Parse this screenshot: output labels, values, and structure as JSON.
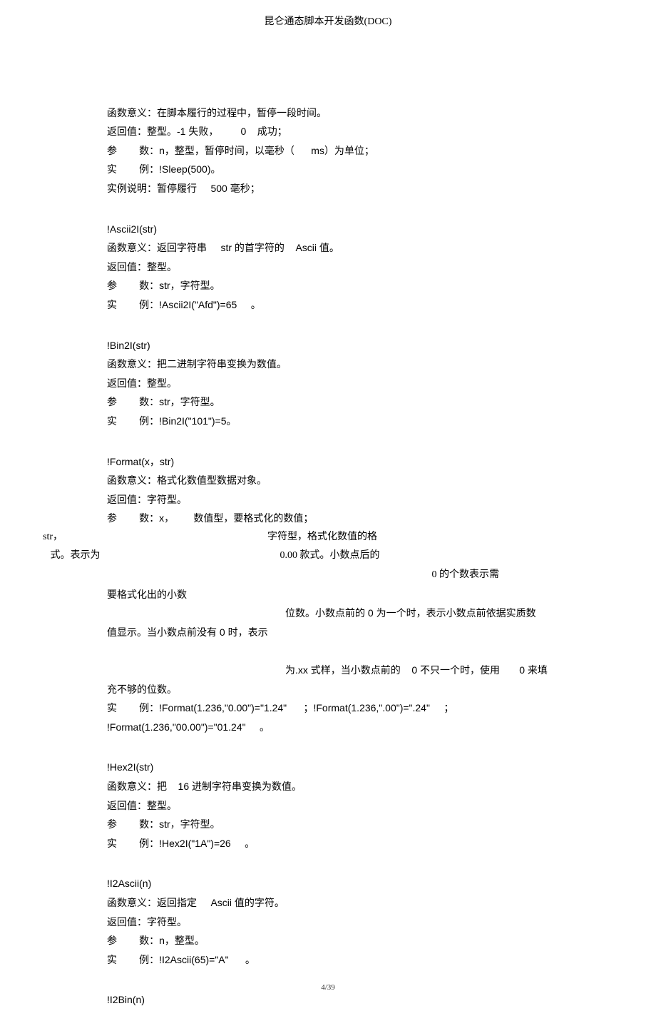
{
  "header": "昆仑通态脚本开发函数(DOC)",
  "footer": "4/39",
  "s1": {
    "l1": "函数意义：在脚本履行的过程中，暂停一段时间。",
    "l2": "返回值：整型。-1 失败，        0    成功；",
    "l3": "参        数：n，整型，暂停时间，以毫秒（      ms）为单位；",
    "l4": "实        例：!Sleep(500)。",
    "l5": "实例说明：暂停履行     500 毫秒；"
  },
  "s2": {
    "l1": "!Ascii2I(str)",
    "l2": "函数意义：返回字符串     str 的首字符的    Ascii 值。",
    "l3": "返回值：整型。",
    "l4": "参        数：str，字符型。",
    "l5": "实        例：!Ascii2I(\"Afd\")=65     。"
  },
  "s3": {
    "l1": "!Bin2I(str)",
    "l2": "函数意义：把二进制字符串变换为数值。",
    "l3": "返回值：整型。",
    "l4": "参        数：str，字符型。",
    "l5": "实        例：!Bin2I(\"101\")=5。"
  },
  "s4": {
    "l1": "!Format(x，str)",
    "l2": "函数意义：格式化数值型数据对象。",
    "l3": "返回值：字符型。",
    "l4": "参        数：x，       数值型，要格式化的数值；",
    "out1": "str，                                                                                  字符型，格式化数值的格",
    "out2": "   式。表示为                                                                        0.00 款式。小数点后的",
    "r1": "0 的个数表示需",
    "l5": "要格式化出的小数",
    "c1": "位数。小数点前的 0 为一个时，表示小数点前依据实质数",
    "l6": "值显示。当小数点前没有 0 时，表示",
    "c2": "为.xx 式样，当小数点前的    0 不只一个时，使用       0 来填",
    "l7": "充不够的位数。",
    "l8": "实        例：!Format(1.236,\"0.00\")=\"1.24\"      ；!Format(1.236,\".00\")=\".24\"     ；",
    "l9": "!Format(1.236,\"00.00\")=\"01.24\"     。"
  },
  "s5": {
    "l1": "!Hex2I(str)",
    "l2": "函数意义：把    16 进制字符串变换为数值。",
    "l3": "返回值：整型。",
    "l4": "参        数：str，字符型。",
    "l5": "实        例：!Hex2I(\"1A\")=26     。"
  },
  "s6": {
    "l1": "!I2Ascii(n)",
    "l2": "函数意义：返回指定     Ascii 值的字符。",
    "l3": "返回值：字符型。",
    "l4": "参        数：n，整型。",
    "l5": "实        例：!I2Ascii(65)=\"A\"      。"
  },
  "s7": {
    "l1": "!I2Bin(n)"
  }
}
